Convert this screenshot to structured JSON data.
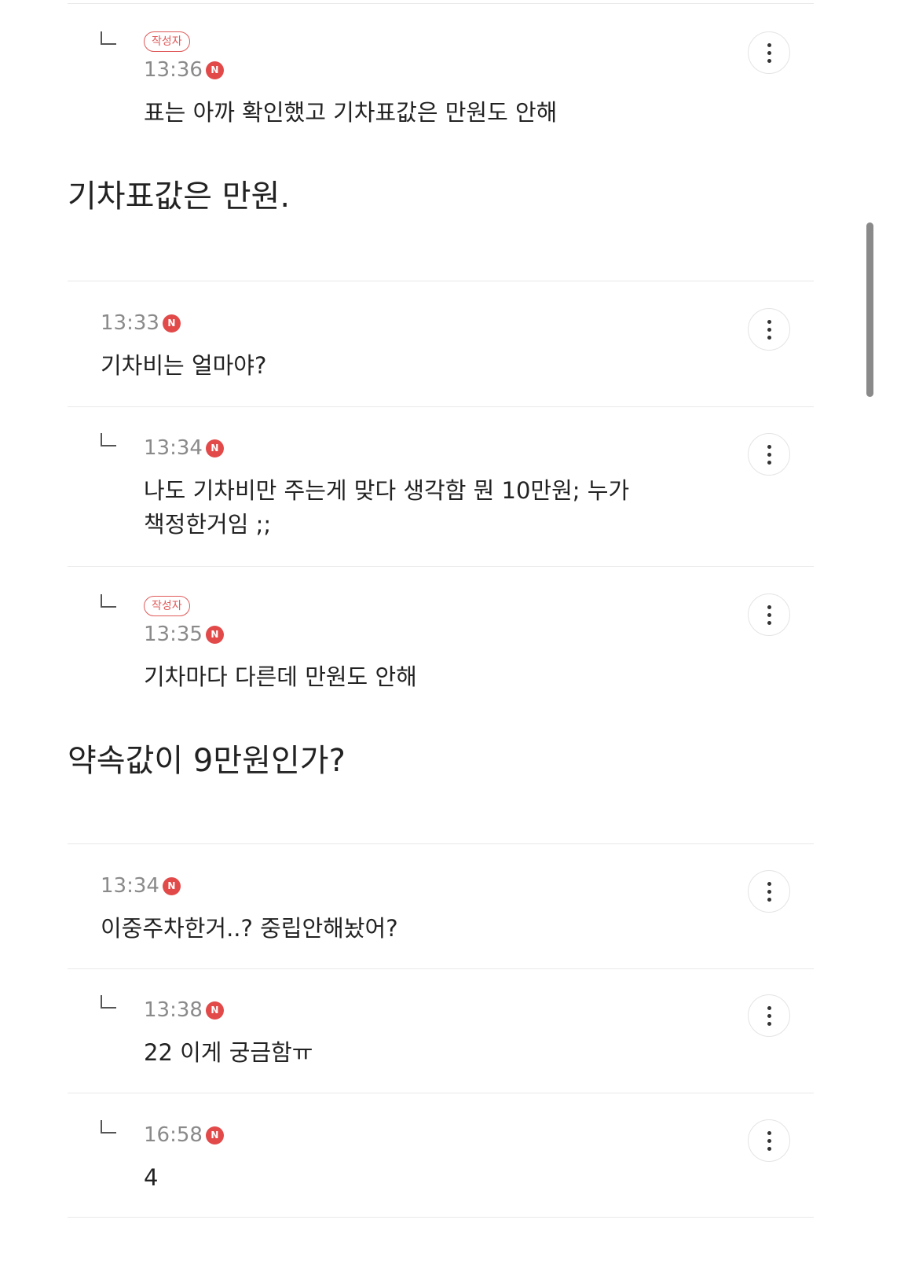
{
  "thread1": {
    "reply": {
      "author_badge": "작성자",
      "time": "13:36",
      "new_label": "N",
      "text": "표는 아까 확인했고 기차표값은 만원도 안해"
    }
  },
  "body1": "기차표값은 만원.",
  "thread2": {
    "comment": {
      "time": "13:33",
      "new_label": "N",
      "text": "기차비는 얼마야?"
    },
    "reply1": {
      "time": "13:34",
      "new_label": "N",
      "text_line1": "나도 기차비만 주는게 맞다 생각함 뭔 10만원; 누가",
      "text_line2": "책정한거임 ;;"
    },
    "reply2": {
      "author_badge": "작성자",
      "time": "13:35",
      "new_label": "N",
      "text": "기차마다 다른데 만원도 안해"
    }
  },
  "body2": "약속값이 9만원인가?",
  "thread3": {
    "comment": {
      "time": "13:34",
      "new_label": "N",
      "text": "이중주차한거..? 중립안해놨어?"
    },
    "reply1": {
      "time": "13:38",
      "new_label": "N",
      "text": "22 이게 궁금함ㅠ"
    },
    "reply2": {
      "time": "16:58",
      "new_label": "N",
      "text": "4"
    }
  }
}
